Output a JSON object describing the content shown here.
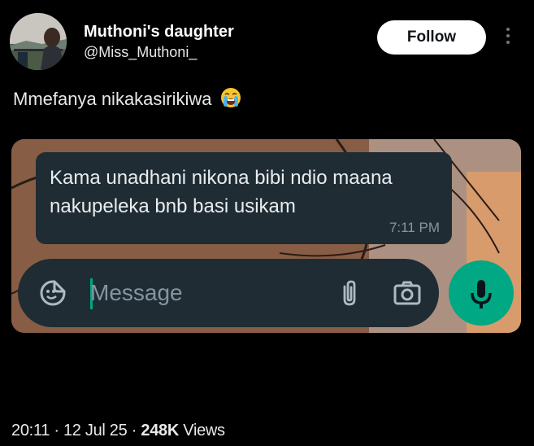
{
  "author": {
    "name": "Muthoni's daughter",
    "handle": "@Miss_Muthoni_",
    "follow_label": "Follow",
    "more_icon": "more-vertical-icon"
  },
  "tweet": {
    "text": "Mmefanya nikakasirikiwa",
    "emoji": "loudly-crying-face"
  },
  "media": {
    "message_text": "Kama unadhani nikona bibi ndio maana nakupeleka bnb basi usikam",
    "message_time": "7:11 PM",
    "composer_placeholder": "Message",
    "icons": [
      "sticker-icon",
      "attachment-icon",
      "camera-icon",
      "microphone-icon"
    ],
    "colors": {
      "bubble": "#1f2c34",
      "accent": "#00a884"
    }
  },
  "footer": {
    "time": "20:11",
    "date": "12 Jul 25",
    "views": "248K",
    "views_label": "Views"
  }
}
